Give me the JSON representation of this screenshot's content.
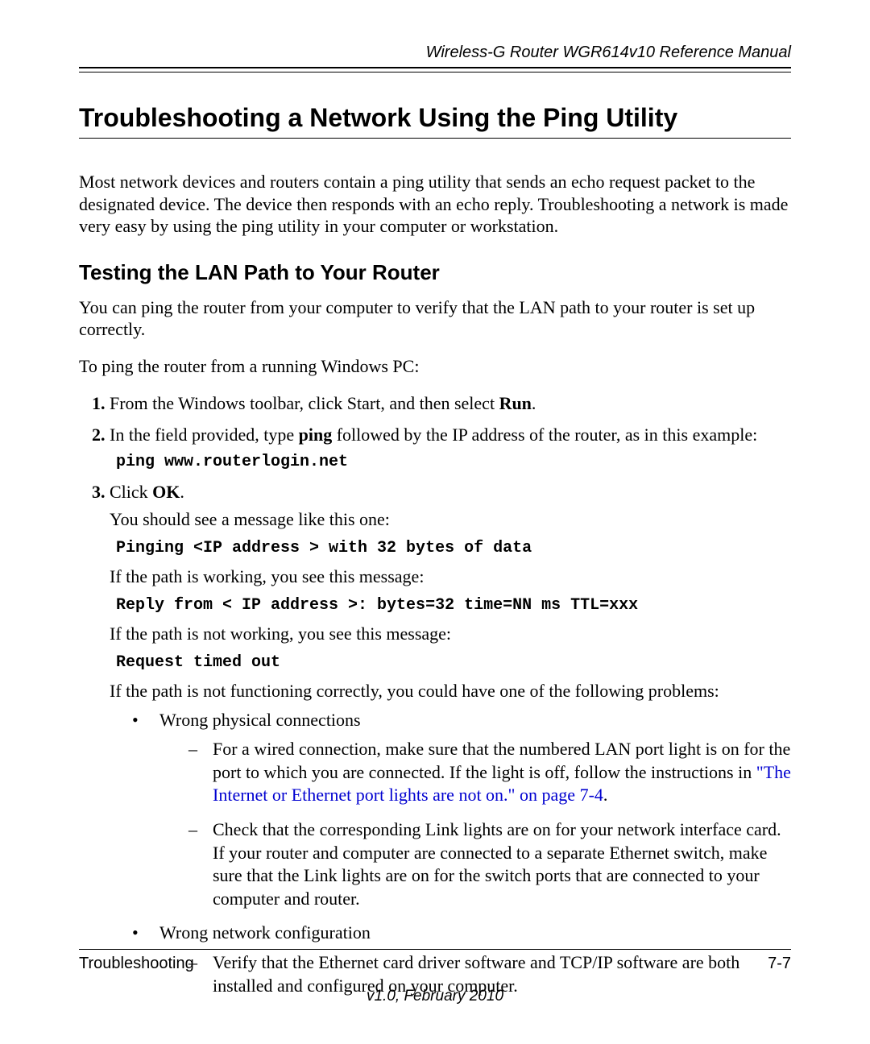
{
  "header": {
    "running_title": "Wireless-G Router WGR614v10 Reference Manual"
  },
  "section": {
    "title": "Troubleshooting a Network Using the Ping Utility",
    "intro": "Most network devices and routers contain a ping utility that sends an echo request packet to the designated device. The device then responds with an echo reply. Troubleshooting a network is made very easy by using the ping utility in your computer or workstation."
  },
  "subsection": {
    "title": "Testing the LAN Path to Your Router",
    "intro": "You can ping the router from your computer to verify that the LAN path to your router is set up correctly.",
    "lead_in": "To ping the router from a running Windows PC:",
    "steps": {
      "s1_pre": "From the Windows toolbar, click Start, and then select ",
      "s1_bold": "Run",
      "s1_post": ".",
      "s2_pre": "In the field provided, type ",
      "s2_bold": "ping",
      "s2_post": " followed by the IP address of the router, as in this example:",
      "s2_code": "ping www.routerlogin.net",
      "s3_pre": "Click ",
      "s3_bold": "OK",
      "s3_post": "."
    },
    "after": {
      "msg_intro": "You should see a message like this one:",
      "msg_code1": "Pinging <IP address > with 32 bytes of data",
      "working": "If the path is working, you see this message:",
      "msg_code2": "Reply from < IP address >: bytes=32 time=NN ms TTL=xxx",
      "not_working": "If the path is not working, you see this message:",
      "msg_code3": "Request timed out",
      "problems_intro": "If the path is not functioning correctly, you could have one of the following problems:"
    },
    "bullets": {
      "b1": "Wrong physical connections",
      "b1_d1_pre": "For a wired connection, make sure that the numbered LAN port light is on for the port to which you are connected. If the light is off, follow the instructions in ",
      "b1_d1_link": "\"The Internet or Ethernet port lights are not on.\" on page 7-4",
      "b1_d1_post": ".",
      "b1_d2": "Check that the corresponding Link lights are on for your network interface card. If your router and computer are connected to a separate Ethernet switch, make sure that the Link lights are on for the switch ports that are connected to your computer and router.",
      "b2": "Wrong network configuration",
      "b2_d1": "Verify that the Ethernet card driver software and TCP/IP software are both installed and configured on your computer."
    }
  },
  "footer": {
    "left": "Troubleshooting",
    "right": "7-7",
    "center": "v1.0, February 2010"
  }
}
